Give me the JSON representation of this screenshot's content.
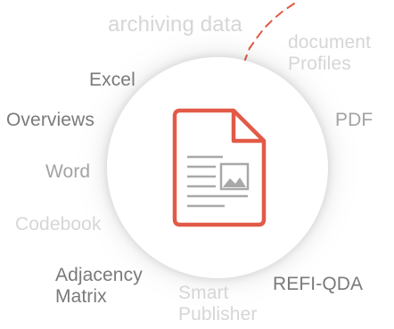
{
  "labels": {
    "archiving_data": "archiving data",
    "document_profiles": "document\nProfiles",
    "excel": "Excel",
    "overviews": "Overviews",
    "pdf": "PDF",
    "word": "Word",
    "codebook": "Codebook",
    "adjacency_matrix": "Adjacency\nMatrix",
    "smart_publisher": "Smart\nPublisher",
    "refi_qda": "REFI-QDA"
  },
  "colors": {
    "accent": "#e25a47",
    "icon_gray": "#a8a8a8",
    "text_dark": "#7a7a7a",
    "text_mid": "#a3a3a3",
    "text_light": "#d6d6d6"
  },
  "icon": "document-with-image-icon"
}
